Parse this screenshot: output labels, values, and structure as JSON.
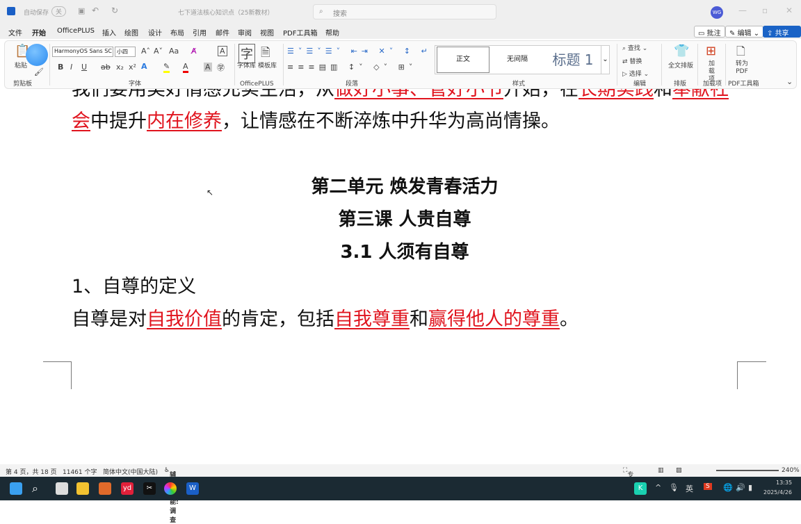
{
  "titlebar": {
    "autosave": "自动保存",
    "toggle": "关",
    "doc_title": "七下道法核心知识点（25新教材）",
    "search_placeholder": "搜索",
    "avatar": "WG"
  },
  "menu": [
    "文件",
    "开始",
    "OfficePLUS",
    "插入",
    "绘图",
    "设计",
    "布局",
    "引用",
    "邮件",
    "审阅",
    "视图",
    "PDF工具箱",
    "帮助"
  ],
  "right_buttons": {
    "comment": "批注",
    "edit": "编辑",
    "share": "共享"
  },
  "ribbon": {
    "clipboard": {
      "paste": "粘贴",
      "group": "剪贴板"
    },
    "font": {
      "name": "HarmonyOS Sans SC",
      "size": "小四",
      "group": "字体"
    },
    "officeplus": {
      "font_lib": "字体库",
      "template_lib": "模板库",
      "group": "OfficePLUS"
    },
    "paragraph": {
      "group": "段落"
    },
    "styles": {
      "items": [
        "正文",
        "无间隔",
        "标题 1"
      ],
      "group": "样式"
    },
    "editing": {
      "find": "查找",
      "replace": "替换",
      "select": "选择",
      "group": "编辑"
    },
    "layout": {
      "full": "全文排版",
      "group": "排版"
    },
    "addins": {
      "label": "加载项",
      "group": "加载项"
    },
    "pdf": {
      "label": "转为PDF",
      "group": "PDF工具箱"
    }
  },
  "document": {
    "line0": {
      "a": "我们要用美好情感充实生活，从",
      "b": "做好小事、管好小节",
      "c": "开始，在",
      "d": "长期实践",
      "e": "和",
      "f": "奉献社"
    },
    "line1": {
      "a": "会",
      "b": "中提升",
      "c": "内在修养",
      "d": "，让情感在不断淬炼中升华为高尚情操。"
    },
    "unit": "第二单元  焕发青春活力",
    "lesson": "第三课  人贵自尊",
    "section": "3.1 人须有自尊",
    "point": "1、自尊的定义",
    "def": {
      "a": "自尊是对",
      "b": "自我价值",
      "c": "的肯定，包括",
      "d": "自我尊重",
      "e": "和",
      "f": "赢得他人的尊重",
      "g": "。"
    }
  },
  "status": {
    "page": "第 4 页，共 18 页",
    "words": "11461 个字",
    "lang": "简体中文(中国大陆)",
    "access": "辅助功能: 调查",
    "focus": "专注",
    "zoom": "240%"
  },
  "taskbar": {
    "lang": "英",
    "time": "13:35",
    "date": "2025/4/26"
  },
  "colors": {
    "accent": "#e0141e",
    "share": "#1a63c6",
    "taskbar": "#1b2a33"
  }
}
